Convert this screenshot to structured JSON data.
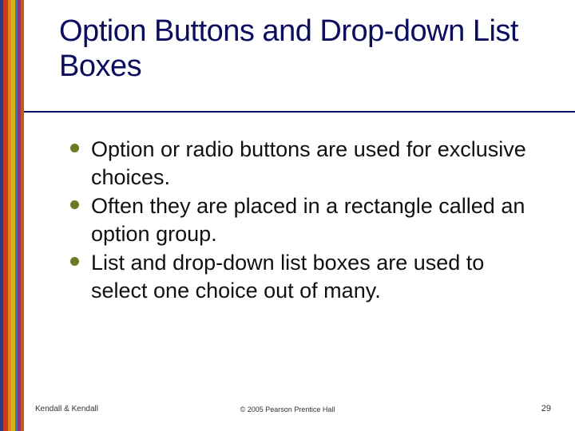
{
  "title": "Option Buttons and Drop-down List Boxes",
  "bullets": [
    "Option or radio buttons are used for exclusive choices.",
    "Often they are placed in a rectangle called an option group.",
    "List and drop-down list boxes are used to select one choice out of many."
  ],
  "footer": {
    "left": "Kendall & Kendall",
    "center": "© 2005 Pearson Prentice Hall",
    "right": "29"
  }
}
